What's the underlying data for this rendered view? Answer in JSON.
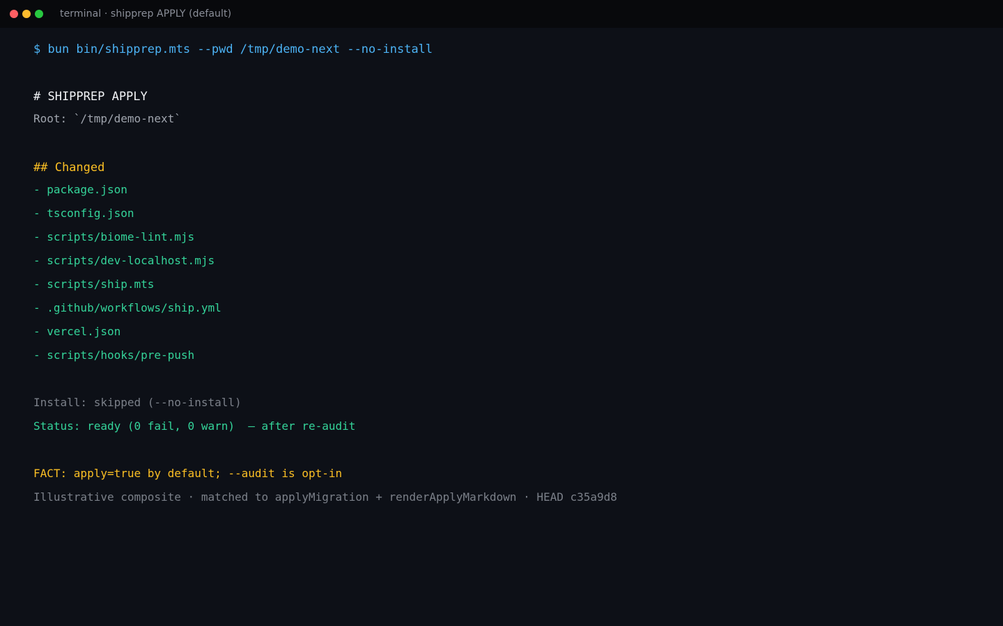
{
  "window": {
    "title": "terminal · shipprep APPLY (default)"
  },
  "terminal": {
    "command": "$ bun bin/shipprep.mts --pwd /tmp/demo-next --no-install",
    "heading": "# SHIPPREP APPLY",
    "root": "Root: `/tmp/demo-next`",
    "changed_heading": "## Changed",
    "changed_files": [
      "- package.json",
      "- tsconfig.json",
      "- scripts/biome-lint.mjs",
      "- scripts/dev-localhost.mjs",
      "- scripts/ship.mts",
      "- .github/workflows/ship.yml",
      "- vercel.json",
      "- scripts/hooks/pre-push"
    ],
    "install": "Install: skipped (--no-install)",
    "status": "Status: ready (0 fail, 0 warn)  — after re-audit",
    "fact": "FACT: apply=true by default; --audit is opt-in",
    "footer": "Illustrative composite · matched to applyMigration + renderApplyMarkdown · HEAD c35a9d8"
  },
  "colors": {
    "background": "#0d1017",
    "titlebar": "#08090c",
    "command": "#4cb3f5",
    "heading": "#f3f5f8",
    "section": "#fbbf24",
    "file": "#34d399",
    "muted": "#a0a5ae",
    "dim": "#7b8089"
  }
}
